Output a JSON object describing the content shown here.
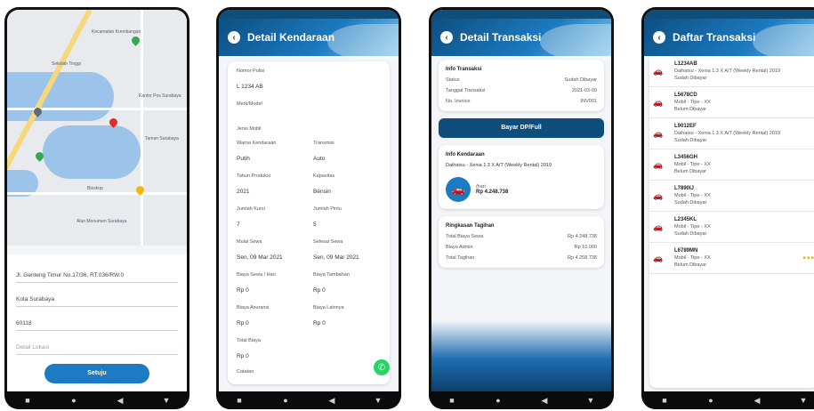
{
  "nav": {
    "square": "■",
    "circle": "●",
    "back": "◀",
    "down": "▼"
  },
  "phone1": {
    "map_labels": [
      "Kecamatan Krembangan",
      "Sekolah Tinggi",
      "Kantor Pos Surabaya",
      "Taman Surabaya",
      "Bioskop",
      "Alun Monumen Surabaya"
    ],
    "address": "Jl. Genteng Timur No.17/36, RT.036/RW.0",
    "city": "Kota Surabaya",
    "field3": "60118",
    "note_placeholder": "Detail Lokasi",
    "button": "Setuju"
  },
  "phone2": {
    "title": "Detail Kendaraan",
    "top_fields": [
      {
        "label": "Nomor Polisi",
        "value": "L 1234 AB"
      },
      {
        "label": "Merk/Model",
        "value": ""
      },
      {
        "label": "Jenis Mobil",
        "value": ""
      }
    ],
    "grid": [
      {
        "label": "Warna Kendaraan",
        "value": "Putih"
      },
      {
        "label": "Transmisi",
        "value": "Auto"
      },
      {
        "label": "Tahun Produksi",
        "value": "2021"
      },
      {
        "label": "Kapasitas",
        "value": "Bensin"
      },
      {
        "label": "Jumlah Kursi",
        "value": "7"
      },
      {
        "label": "Jumlah Pintu",
        "value": "5"
      },
      {
        "label": "Mulai Sewa",
        "value": "Sen, 09 Mar 2021"
      },
      {
        "label": "Selesai Sewa",
        "value": "Sen, 09 Mar 2021"
      },
      {
        "label": "Biaya Sewa / Hari",
        "value": "Rp 0"
      },
      {
        "label": "Biaya Tambahan",
        "value": "Rp 0"
      },
      {
        "label": "Biaya Asuransi",
        "value": "Rp 0"
      },
      {
        "label": "Biaya Lainnya",
        "value": "Rp 0"
      }
    ],
    "extra_label": "Total Biaya",
    "extra_value": "Rp 0",
    "bottom_label": "Catatan",
    "whatsapp": "✆"
  },
  "phone3": {
    "title": "Detail Transaksi",
    "info_title": "Info Transaksi",
    "info_rows": [
      {
        "k": "Status",
        "v": "Sudah Dibayar"
      },
      {
        "k": "Tanggal Transaksi",
        "v": "2021-03-09"
      },
      {
        "k": "No. Invoice",
        "v": "INV001"
      }
    ],
    "pay_button": "Bayar DP/Full",
    "vehicle_title": "Info Kendaraan",
    "vehicle_name": "Daihatsu - Xenia 1.3 X A/T (Weekly Rental) 2019",
    "price_sub": "/hari",
    "price": "Rp 4.248.738",
    "summary_title": "Ringkasan Tagihan",
    "summary_rows": [
      {
        "k": "Total Biaya Sewa",
        "v": "Rp 4.248.738"
      },
      {
        "k": "Biaya Admin",
        "v": "Rp 10.000"
      },
      {
        "k": "Total Tagihan",
        "v": "Rp 4.258.738"
      }
    ]
  },
  "phone4": {
    "title": "Daftar Transaksi",
    "items": [
      {
        "code": "L1234AB",
        "car": "Daihatsu - Xenia 1.3 X A/T (Weekly Rental) 2019",
        "sub": "Sudah Dibayar",
        "status": ""
      },
      {
        "code": "L5678CD",
        "car": "Mobil - Tipe - XX",
        "sub": "Belum Dibayar",
        "status": ""
      },
      {
        "code": "L9012EF",
        "car": "Daihatsu - Xenia 1.3 X A/T (Weekly Rental) 2019",
        "sub": "Sudah Dibayar",
        "status": ""
      },
      {
        "code": "L3456GH",
        "car": "Mobil - Tipe - XX",
        "sub": "Belum Dibayar",
        "status": ""
      },
      {
        "code": "L7890IJ",
        "car": "Mobil - Tipe - XX",
        "sub": "Sudah Dibayar",
        "status": ""
      },
      {
        "code": "L2345KL",
        "car": "Mobil - Tipe - XX",
        "sub": "Sudah Dibayar",
        "status": ""
      },
      {
        "code": "L6789MN",
        "car": "Mobil - Tipe - XX",
        "sub": "Belum Dibayar",
        "status": "•••"
      }
    ]
  },
  "colors": {
    "primary": "#0f4d7a",
    "accent": "#1d7bc4",
    "whatsapp": "#25d366"
  }
}
